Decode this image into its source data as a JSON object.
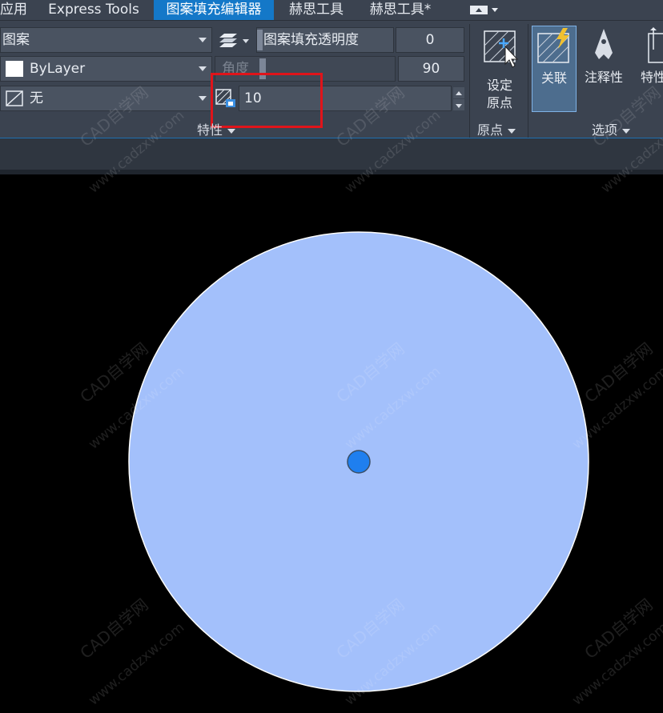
{
  "tabs": [
    {
      "label": "应用",
      "active": false
    },
    {
      "label": "Express Tools",
      "active": false
    },
    {
      "label": "图案填充编辑器",
      "active": true
    },
    {
      "label": "赫思工具",
      "active": false
    },
    {
      "label": "赫思工具*",
      "active": false
    }
  ],
  "properties": {
    "pattern_type": "图案",
    "color_value": "ByLayer",
    "background_value": "无",
    "transparency_label": "图案填充透明度",
    "transparency_value": "0",
    "angle_label": "角度",
    "angle_value": "90",
    "scale_value": "10",
    "panel_label": "特性"
  },
  "origin": {
    "set_origin_label_line1": "设定",
    "set_origin_label_line2": "原点",
    "panel_label": "原点"
  },
  "options": {
    "associative_label": "关联",
    "annotative_label": "注释性",
    "match_properties_label": "特性",
    "panel_label": "选项"
  },
  "watermark": {
    "brand": "CAD自学网",
    "url": "www.cadzxw.com"
  },
  "colors": {
    "ribbon_bg": "#3b4350",
    "active_tab": "#1478c8",
    "highlight_box": "#e0141a",
    "hatch_fill": "#a3c0fb",
    "center_dot": "#1f7fef"
  }
}
